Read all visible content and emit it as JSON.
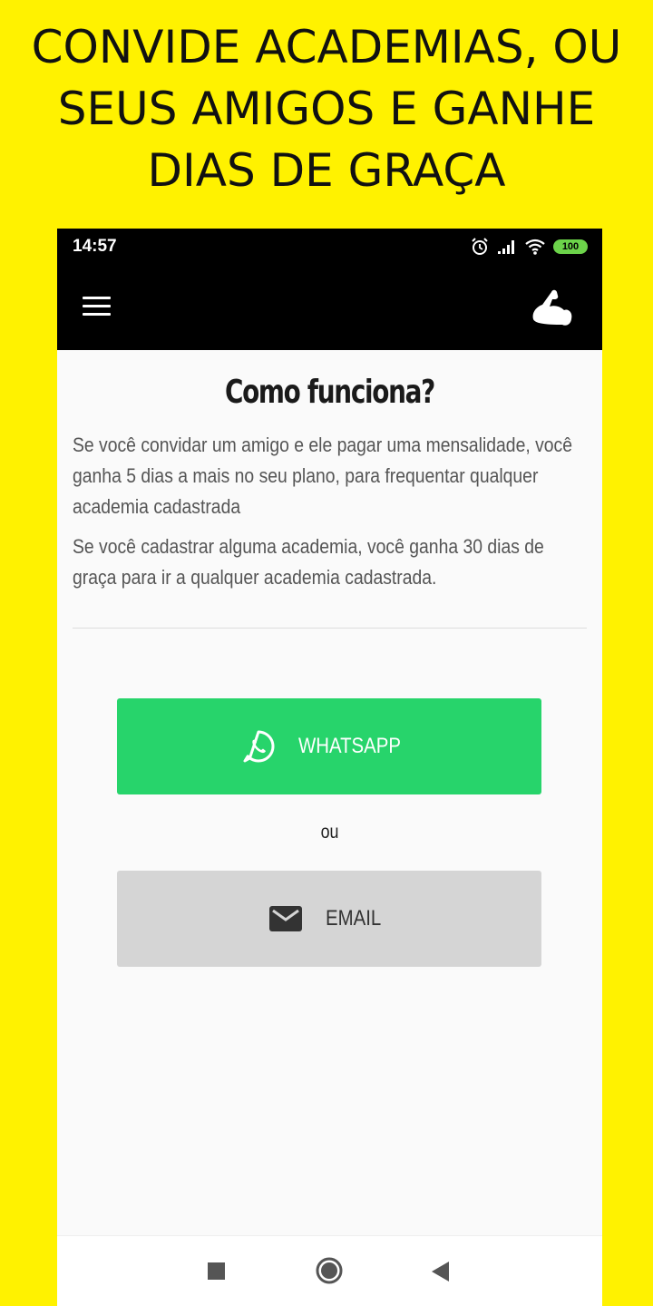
{
  "promo": {
    "line1": "CONVIDE ACADEMIAS, OU",
    "line2": "SEUS AMIGOS E GANHE",
    "line3": "DIAS DE GRAÇA"
  },
  "status_bar": {
    "time": "14:57",
    "battery": "100",
    "icons": [
      "alarm-icon",
      "signal-icon",
      "wifi-icon",
      "battery-icon"
    ]
  },
  "app_bar": {
    "menu_icon": "hamburger-menu-icon",
    "logo_icon": "flexed-arm-icon"
  },
  "content": {
    "title": "Como funciona?",
    "paragraph_1": "Se você convidar um amigo e ele pagar uma mensalidade, você ganha 5 dias a mais no seu plano, para frequentar qualquer academia cadastrada",
    "paragraph_2": "Se você cadastrar alguma academia, você ganha 30 dias de graça para ir a qualquer academia cadastrada.",
    "whatsapp_label": "WHATSAPP",
    "separator_label": "ou",
    "email_label": "EMAIL"
  },
  "colors": {
    "background": "#fff200",
    "whatsapp": "#27d46b",
    "email": "#d5d5d5",
    "app_bar": "#000000"
  },
  "nav": {
    "icons": [
      "recents-square-icon",
      "home-circle-icon",
      "back-triangle-icon"
    ]
  }
}
